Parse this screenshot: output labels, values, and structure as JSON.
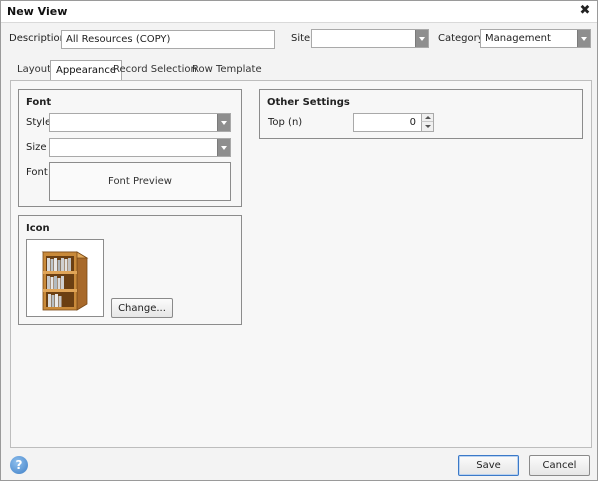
{
  "window": {
    "title": "New View",
    "close_glyph": "✖"
  },
  "form": {
    "description_label": "Description",
    "description_value": "All Resources (COPY)",
    "site_label": "Site",
    "site_value": "",
    "category_label": "Category",
    "category_value": "Management"
  },
  "tabs": [
    {
      "label": "Layout",
      "active": false
    },
    {
      "label": "Appearance",
      "active": true
    },
    {
      "label": "Record Selection",
      "active": false
    },
    {
      "label": "Row Template",
      "active": false
    }
  ],
  "font_group": {
    "title": "Font",
    "style_label": "Style",
    "style_value": "",
    "size_label": "Size",
    "size_value": "",
    "font_label": "Font",
    "preview_text": "Font Preview"
  },
  "icon_group": {
    "title": "Icon",
    "icon": "bookshelf-icon",
    "change_label": "Change..."
  },
  "other_settings": {
    "title": "Other Settings",
    "top_label": "Top (n)",
    "top_value": "0"
  },
  "footer": {
    "help_glyph": "?",
    "save_label": "Save",
    "cancel_label": "Cancel"
  },
  "colors": {
    "focus_accent": "#3b79c8",
    "help_blue": "#3f7fc6",
    "shelf_wood": "#c98a3a"
  }
}
